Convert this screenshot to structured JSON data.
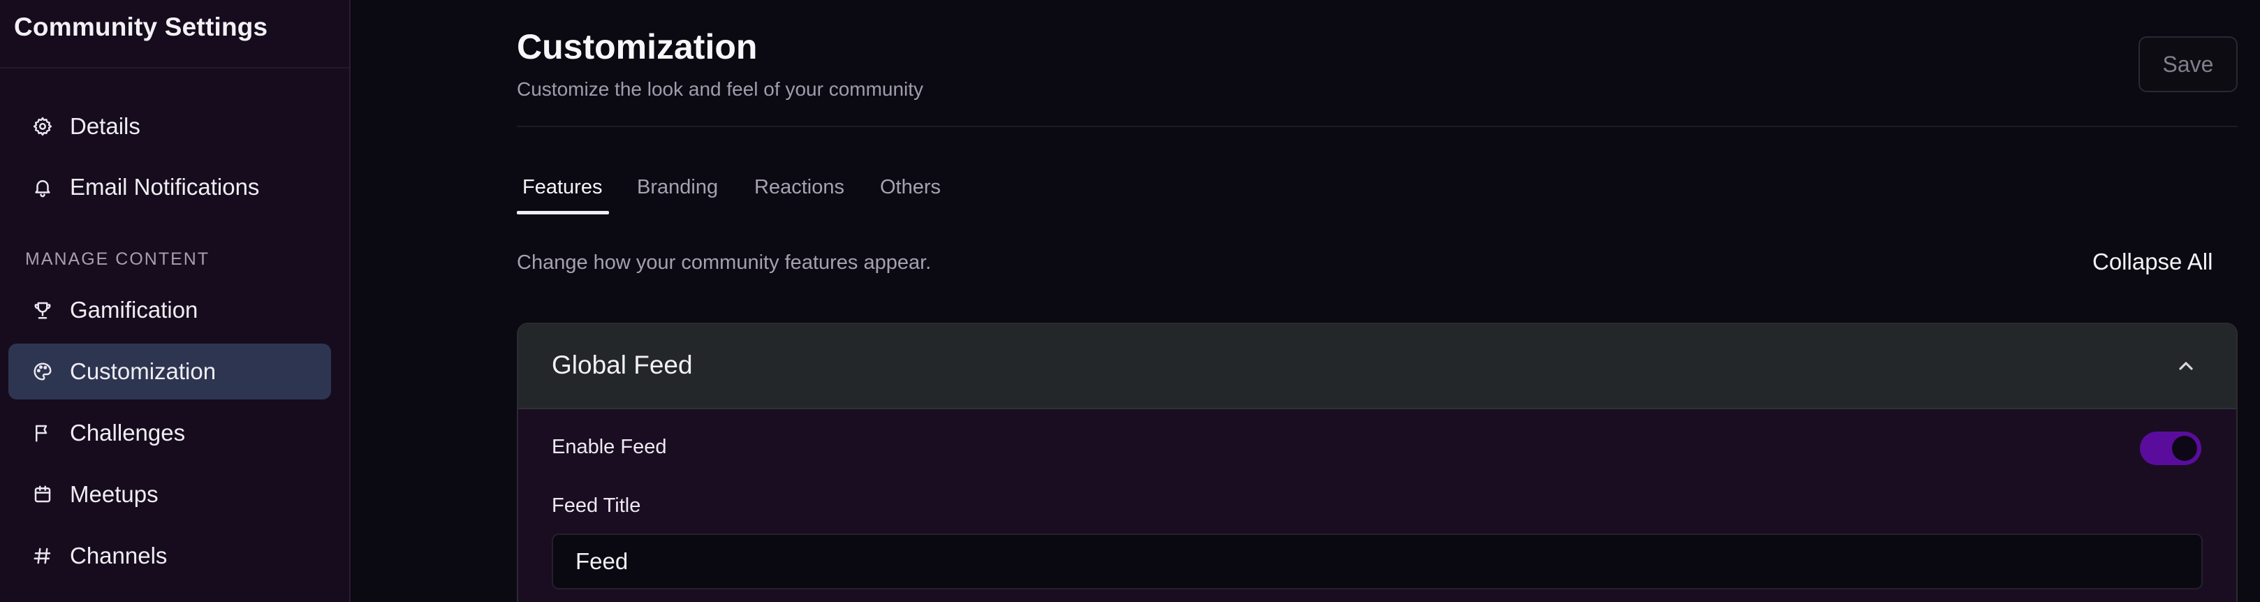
{
  "sidebar": {
    "title": "Community Settings",
    "items": [
      {
        "label": "Details",
        "icon": "gear-icon"
      },
      {
        "label": "Email Notifications",
        "icon": "bell-icon"
      }
    ],
    "section_label": "MANAGE CONTENT",
    "manage_items": [
      {
        "label": "Gamification",
        "icon": "trophy-icon"
      },
      {
        "label": "Customization",
        "icon": "palette-icon",
        "active": true
      },
      {
        "label": "Challenges",
        "icon": "flag-icon"
      },
      {
        "label": "Meetups",
        "icon": "calendar-icon"
      },
      {
        "label": "Channels",
        "icon": "hash-icon"
      }
    ]
  },
  "header": {
    "title": "Customization",
    "subtitle": "Customize the look and feel of your community",
    "save_label": "Save"
  },
  "tabs": [
    {
      "label": "Features",
      "active": true
    },
    {
      "label": "Branding"
    },
    {
      "label": "Reactions"
    },
    {
      "label": "Others"
    }
  ],
  "section": {
    "description": "Change how your community features appear.",
    "collapse_all_label": "Collapse All"
  },
  "card": {
    "title": "Global Feed",
    "enable_label": "Enable Feed",
    "enabled": true,
    "feed_title_label": "Feed Title",
    "feed_title_value": "Feed"
  },
  "colors": {
    "sidebar_bg": "#160c1d",
    "active_item_bg": "#2e3551",
    "toggle_on": "#5a0d9c",
    "card_header_bg": "#23272a",
    "card_body_bg": "#1a0d22"
  }
}
